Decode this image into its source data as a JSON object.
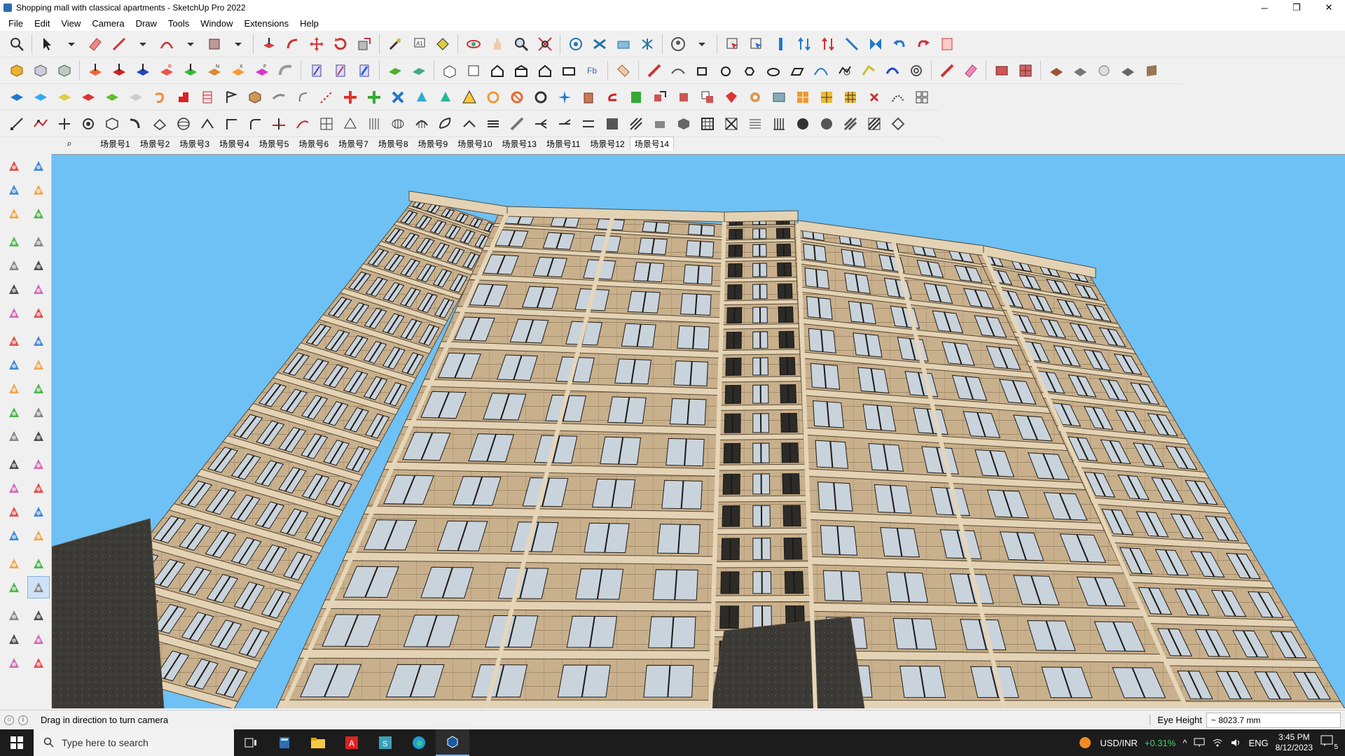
{
  "window": {
    "title": "Shopping mall with classical apartments - SketchUp Pro 2022",
    "minimize_glyph": "─",
    "restore_glyph": "❐",
    "close_glyph": "✕"
  },
  "menu": [
    "File",
    "Edit",
    "View",
    "Camera",
    "Draw",
    "Tools",
    "Window",
    "Extensions",
    "Help"
  ],
  "scenes": {
    "search_icon": "⌕",
    "tabs": [
      "场景号1",
      "场景号2",
      "场景号3",
      "场景号4",
      "场景号5",
      "场景号6",
      "场景号7",
      "场景号8",
      "场景号9",
      "场景号10",
      "场景号13",
      "场景号11",
      "场景号12",
      "场景号14"
    ],
    "active": "场景号14"
  },
  "colors": {
    "sky": "#6ec1f5",
    "facade": "#c9b08c",
    "trim": "#e3d3b4",
    "window": "#c9d3dc",
    "dark_stone": "#3b3a36",
    "accent": "#d64545"
  },
  "left_tools": [
    [
      "select-arrow-icon",
      "orbit-icon"
    ],
    [
      "paint-bucket-icon",
      "eraser-icon"
    ],
    [
      "component-icon",
      "tag-icon"
    ],
    [
      "line-pencil-icon",
      "freehand-icon"
    ],
    [
      "rectangle-icon",
      "rotated-rectangle-icon"
    ],
    [
      "circle-icon",
      "polygon-icon"
    ],
    [
      "arc-icon",
      "two-point-arc-icon"
    ],
    [
      "three-point-arc-icon",
      "pie-icon"
    ],
    [
      "move-icon",
      "push-pull-icon"
    ],
    [
      "rotate-icon",
      "follow-me-icon"
    ],
    [
      "scale-icon",
      "offset-icon"
    ],
    [
      "tape-measure-icon",
      "dimension-icon"
    ],
    [
      "protractor-icon",
      "text-icon"
    ],
    [
      "axes-icon",
      "3d-text-icon"
    ],
    [
      "orbit-tool-icon",
      "pan-icon"
    ],
    [
      "zoom-icon",
      "zoom-window-icon"
    ],
    [
      "zoom-extents-icon",
      "previous-view-icon"
    ],
    [
      "position-camera-icon",
      "look-around-icon"
    ],
    [
      "walk-icon",
      "section-plane-icon"
    ],
    [
      "warehouse-icon",
      "extension-warehouse-icon"
    ],
    [
      "layout-icon",
      "extension-manager-icon"
    ]
  ],
  "status": {
    "message": "Drag in direction to turn camera",
    "measure_label": "Eye Height",
    "measure_value": "~ 8023.7 mm"
  },
  "taskbar": {
    "search_placeholder": "Type here to search",
    "ticker_symbol": "USD/INR",
    "ticker_change": "+0.31%",
    "language": "ENG",
    "time": "3:45 PM",
    "date": "8/12/2023",
    "notifications": "5"
  }
}
